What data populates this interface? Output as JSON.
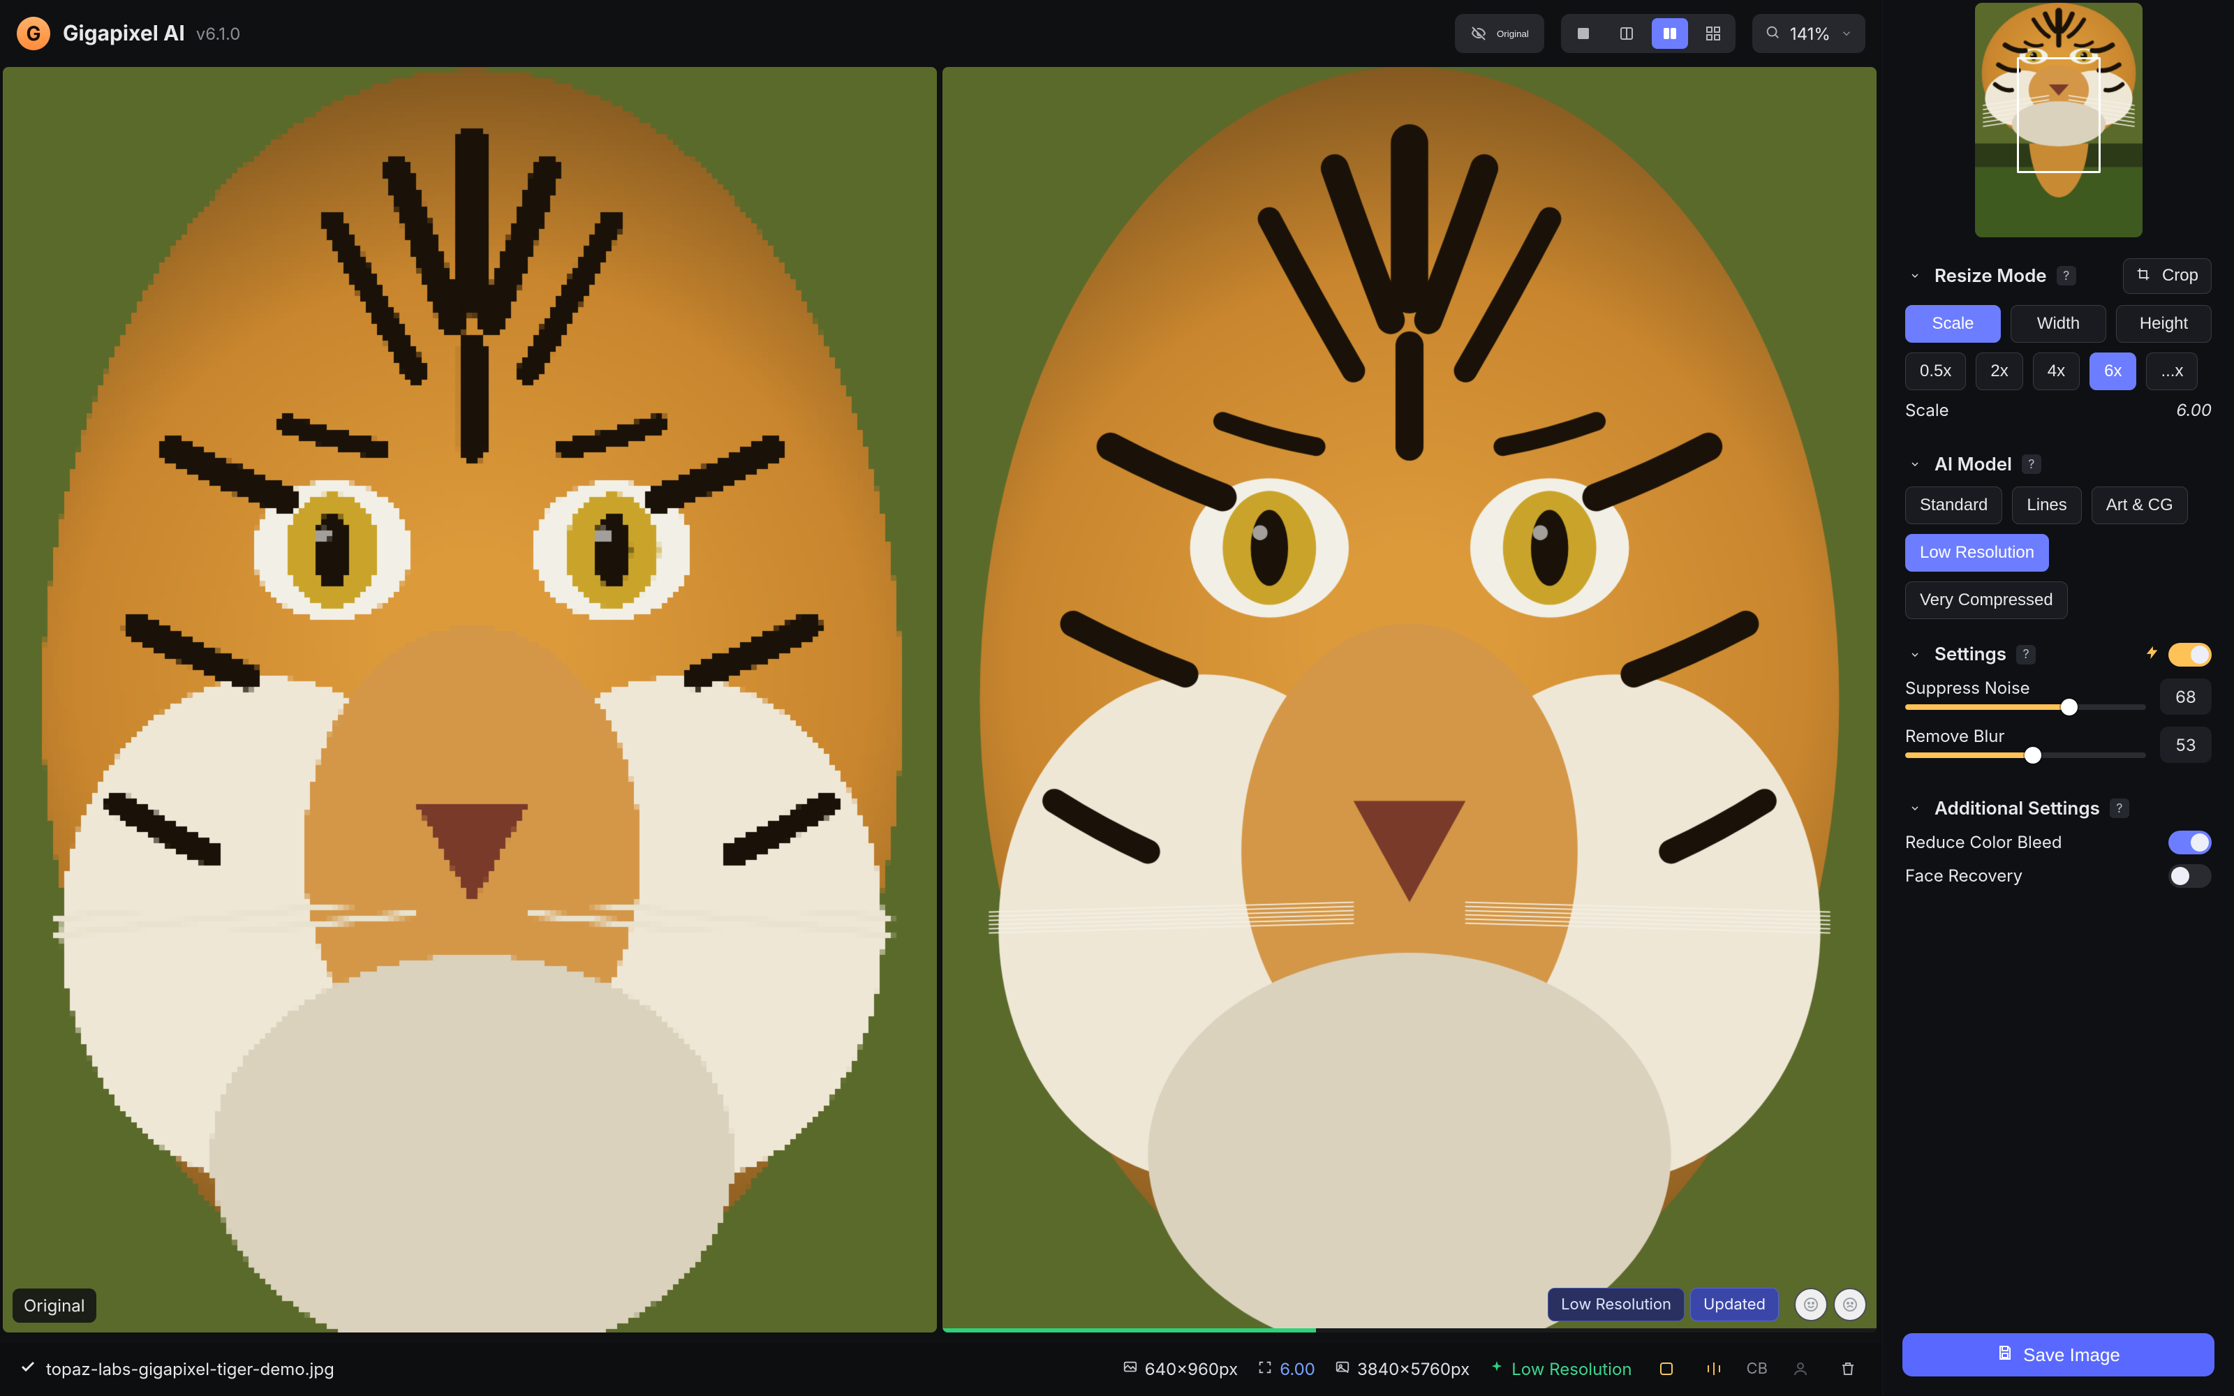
{
  "app": {
    "name": "Gigapixel AI",
    "version": "v6.1.0"
  },
  "toolbar": {
    "original_label": "Original",
    "views": [
      "single",
      "split",
      "side-by-side",
      "preview-grid"
    ],
    "active_view": 2,
    "zoom": "141%"
  },
  "viewer": {
    "left_label": "Original",
    "chips": {
      "model": "Low Resolution",
      "status": "Updated"
    },
    "feedback": {
      "good": "good-icon",
      "bad": "bad-icon"
    }
  },
  "sidebar": {
    "resize_mode": {
      "title": "Resize Mode",
      "crop_label": "Crop",
      "tabs": [
        "Scale",
        "Width",
        "Height"
      ],
      "active_tab": 0,
      "scale_presets": [
        "0.5x",
        "2x",
        "4x",
        "6x",
        "...x"
      ],
      "active_preset": 3,
      "scale_label": "Scale",
      "scale_value": "6.00"
    },
    "ai_model": {
      "title": "AI Model",
      "options": [
        "Standard",
        "Lines",
        "Art & CG",
        "Low Resolution",
        "Very Compressed"
      ],
      "active": 3
    },
    "settings": {
      "title": "Settings",
      "auto_on": true,
      "sliders": [
        {
          "label": "Suppress Noise",
          "value": 68,
          "max": 100
        },
        {
          "label": "Remove Blur",
          "value": 53,
          "max": 100
        }
      ]
    },
    "additional": {
      "title": "Additional Settings",
      "reduce_color_bleed": {
        "label": "Reduce Color Bleed",
        "on": true
      },
      "face_recovery": {
        "label": "Face Recovery",
        "on": false
      }
    }
  },
  "bottombar": {
    "filename": "topaz-labs-gigapixel-tiger-demo.jpg",
    "src_dim": "640x960px",
    "scale_factor": "6.00",
    "out_dim": "3840x5760px",
    "model_badge": "Low Resolution",
    "cb_label": "CB"
  },
  "cta": {
    "label": "Save Image"
  }
}
